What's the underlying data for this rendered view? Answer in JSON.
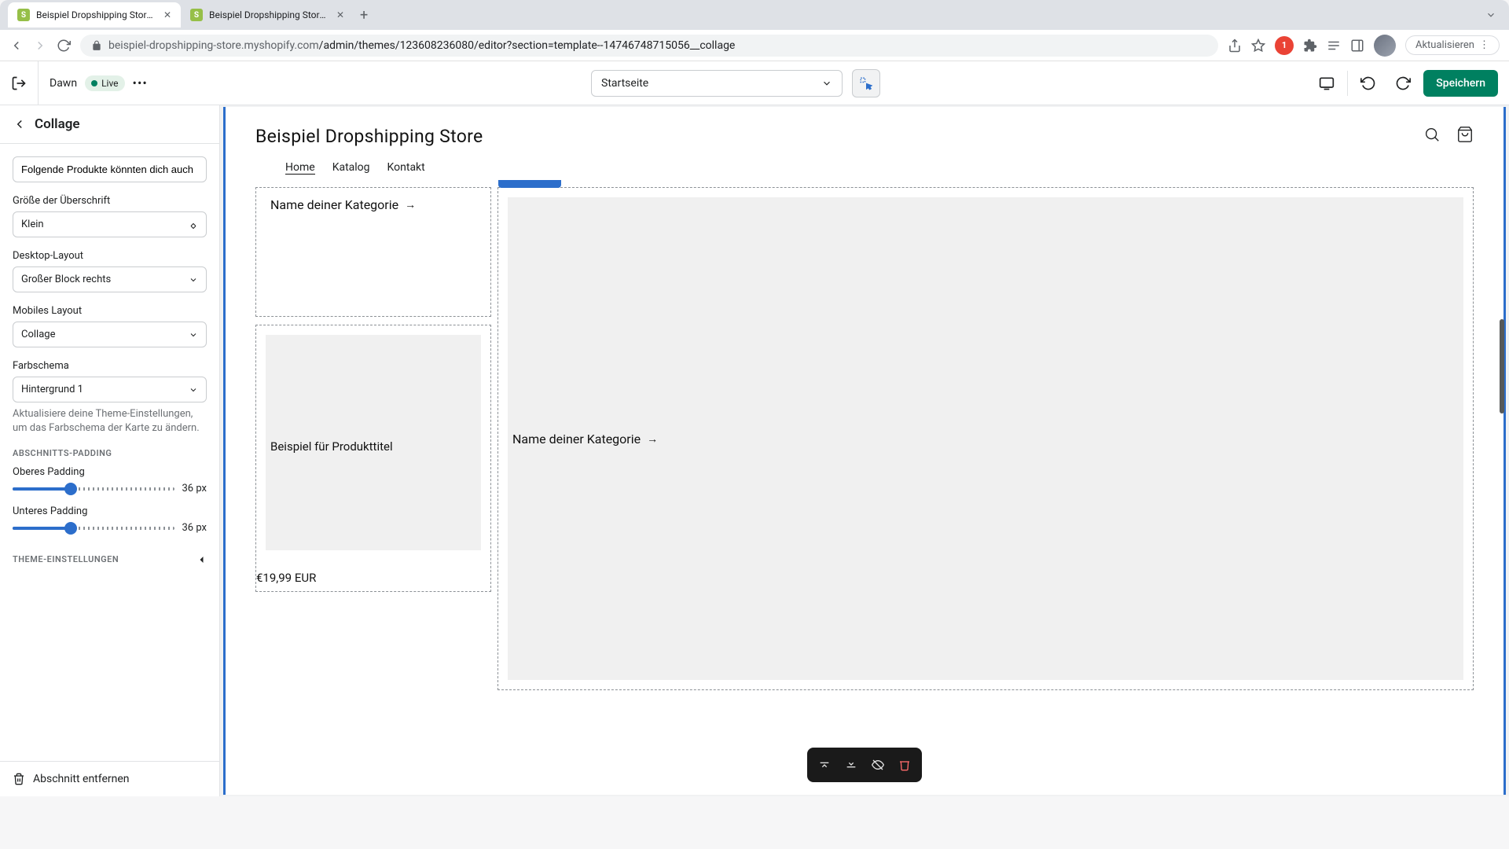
{
  "browser": {
    "tabs": [
      {
        "label": "Beispiel Dropshipping Store · D"
      },
      {
        "label": "Beispiel Dropshipping Store · E"
      }
    ],
    "url_host": "beispiel-dropshipping-store.myshopify.com",
    "url_path": "/admin/themes/123608236080/editor?section=template--14746748715056__collage",
    "update_label": "Aktualisieren"
  },
  "toolbar": {
    "theme_name": "Dawn",
    "live_label": "Live",
    "page_selector": "Startseite",
    "save_label": "Speichern"
  },
  "sidebar": {
    "title": "Collage",
    "text_input": "Folgende Produkte könnten dich auch",
    "heading_size_label": "Größe der Überschrift",
    "heading_size_value": "Klein",
    "desktop_layout_label": "Desktop-Layout",
    "desktop_layout_value": "Großer Block rechts",
    "mobile_layout_label": "Mobiles Layout",
    "mobile_layout_value": "Collage",
    "color_scheme_label": "Farbschema",
    "color_scheme_value": "Hintergrund 1",
    "color_scheme_help": "Aktualisiere deine Theme-Einstellungen, um das Farbschema der Karte zu ändern.",
    "section_padding_heading": "ABSCHNITTS-PADDING",
    "top_padding_label": "Oberes Padding",
    "top_padding_value": "36 px",
    "top_padding_pct": 36,
    "bottom_padding_label": "Unteres Padding",
    "bottom_padding_value": "36 px",
    "bottom_padding_pct": 36,
    "theme_settings_label": "THEME-EINSTELLUNGEN",
    "remove_section_label": "Abschnitt entfernen"
  },
  "preview": {
    "store_title": "Beispiel Dropshipping Store",
    "nav": {
      "home": "Home",
      "katalog": "Katalog",
      "kontakt": "Kontakt"
    },
    "category_placeholder": "Name deiner Kategorie",
    "product_title_placeholder": "Beispiel für Produkttitel",
    "price": "€19,99 EUR"
  }
}
